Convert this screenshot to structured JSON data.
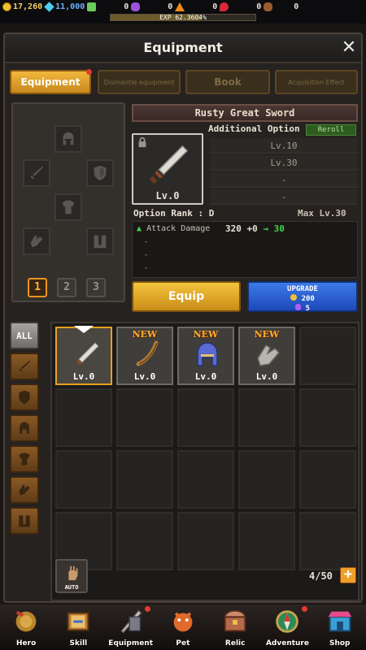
{
  "topbar": {
    "gold": "17,260",
    "diamonds": "11,000",
    "green_gems": "0",
    "purple_gems": "0",
    "orange_gems": "0",
    "red_gems": "0",
    "stones": "0",
    "exp_label": "EXP 62.3604%",
    "exp_progress_percent": 62.3604
  },
  "panel": {
    "title": "Equipment",
    "tabs": [
      "Equipment",
      "Dismantle equipment",
      "Book",
      "Acquisition Effect"
    ]
  },
  "loadout": {
    "slots": [
      "helmet-icon",
      "sword-icon",
      "shield-icon",
      "armor-icon",
      "glove-icon",
      "boots-icon"
    ],
    "sets": [
      "1",
      "2",
      "3"
    ],
    "active_set": "1"
  },
  "item": {
    "name": "Rusty Great Sword",
    "level": "Lv.0",
    "additional_option_label": "Additional Option",
    "reroll_label": "Reroll",
    "option_rows": [
      "Lv.10",
      "Lv.30",
      "-",
      "-"
    ],
    "option_rank": "Option Rank : D",
    "max_level": "Max Lv.30",
    "stat_name": "Attack Damage",
    "stat_base": "320",
    "stat_bonus": "+0",
    "stat_arrow": "→",
    "stat_next": "30",
    "extra_lines": [
      "-",
      "-",
      "-"
    ]
  },
  "actions": {
    "equip_label": "Equip",
    "upgrade_label": "UPGRADE",
    "upgrade_gold": "200",
    "upgrade_gems": "5"
  },
  "inventory": {
    "categories": [
      "ALL",
      "sword-icon",
      "shield-icon",
      "helmet-icon",
      "armor-icon",
      "glove-icon",
      "boots-icon"
    ],
    "items": [
      {
        "icon": "sword-icon",
        "level": "Lv.0",
        "new": "",
        "selected": true
      },
      {
        "icon": "bow-icon",
        "level": "Lv.0",
        "new": "NEW",
        "selected": false
      },
      {
        "icon": "helmet-icon",
        "level": "Lv.0",
        "new": "NEW",
        "selected": false
      },
      {
        "icon": "glove-icon",
        "level": "Lv.0",
        "new": "NEW",
        "selected": false
      }
    ],
    "auto_label": "AUTO",
    "count": "4/50",
    "add_label": "+"
  },
  "nav": [
    {
      "label": "Hero",
      "icon": "hero-icon"
    },
    {
      "label": "Skill",
      "icon": "skill-book-icon"
    },
    {
      "label": "Equipment",
      "icon": "equipment-icon"
    },
    {
      "label": "Pet",
      "icon": "pet-icon"
    },
    {
      "label": "Relic",
      "icon": "relic-chest-icon"
    },
    {
      "label": "Adventure",
      "icon": "compass-icon"
    },
    {
      "label": "Shop",
      "icon": "shop-icon"
    }
  ]
}
